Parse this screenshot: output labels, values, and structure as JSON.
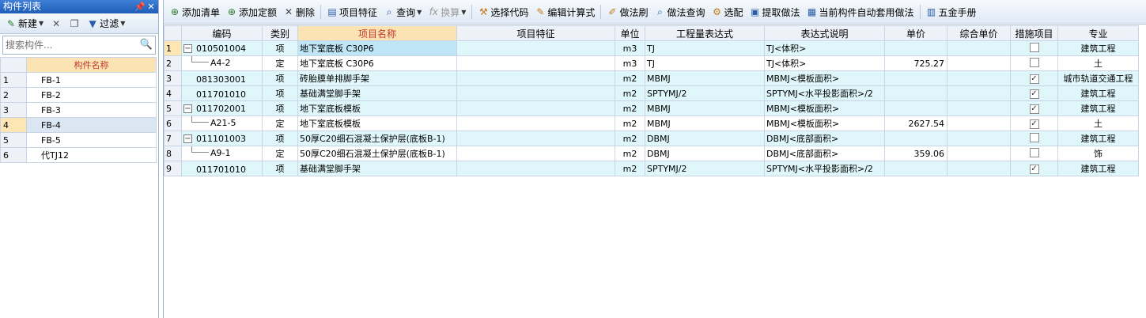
{
  "left_panel": {
    "title": "构件列表",
    "pin_icon": "pin-icon",
    "close_icon": "close-icon",
    "toolbar": {
      "new_label": "新建",
      "filter_label": "过滤"
    },
    "search": {
      "placeholder": "搜索构件..."
    },
    "table": {
      "header": "构件名称",
      "rows": [
        {
          "idx": "1",
          "name": "FB-1"
        },
        {
          "idx": "2",
          "name": "FB-2"
        },
        {
          "idx": "3",
          "name": "FB-3"
        },
        {
          "idx": "4",
          "name": "FB-4"
        },
        {
          "idx": "5",
          "name": "FB-5"
        },
        {
          "idx": "6",
          "name": "代TJ12"
        }
      ],
      "selected_index": 3
    }
  },
  "toolbar": {
    "add_list": "添加清单",
    "add_quota": "添加定额",
    "delete": "删除",
    "item_feature": "项目特征",
    "query": "查询",
    "convert": "换算",
    "select_code": "选择代码",
    "edit_formula": "编辑计算式",
    "method_brush": "做法刷",
    "method_query": "做法查询",
    "select_match": "选配",
    "extract_method": "提取做法",
    "auto_apply": "当前构件自动套用做法",
    "hardware_manual": "五金手册"
  },
  "grid": {
    "columns": [
      "编码",
      "类别",
      "项目名称",
      "项目特征",
      "单位",
      "工程量表达式",
      "表达式说明",
      "单价",
      "综合单价",
      "措施项目",
      "专业"
    ],
    "rows": [
      {
        "rn": "1",
        "code": "010501004",
        "type": "项",
        "name": "地下室底板 C30P6",
        "feature": "",
        "unit": "m3",
        "expr": "TJ",
        "desc": "TJ<体积>",
        "price": "",
        "total": "",
        "measure": false,
        "major": "建筑工程",
        "level": "parent",
        "cyan": true,
        "selected": true
      },
      {
        "rn": "2",
        "code": "A4-2",
        "type": "定",
        "name": "地下室底板 C30P6",
        "feature": "",
        "unit": "m3",
        "expr": "TJ",
        "desc": "TJ<体积>",
        "price": "725.27",
        "total": "",
        "measure": false,
        "major": "土",
        "level": "child",
        "cyan": false,
        "selected": false
      },
      {
        "rn": "3",
        "code": "081303001",
        "type": "项",
        "name": "砖胎膜单排脚手架",
        "feature": "",
        "unit": "m2",
        "expr": "MBMJ",
        "desc": "MBMJ<模板面积>",
        "price": "",
        "total": "",
        "measure": true,
        "major": "城市轨道交通工程",
        "level": "plain",
        "cyan": true,
        "selected": false
      },
      {
        "rn": "4",
        "code": "011701010",
        "type": "项",
        "name": "基础满堂脚手架",
        "feature": "",
        "unit": "m2",
        "expr": "SPTYMJ/2",
        "desc": "SPTYMJ<水平投影面积>/2",
        "price": "",
        "total": "",
        "measure": true,
        "major": "建筑工程",
        "level": "plain",
        "cyan": true,
        "selected": false
      },
      {
        "rn": "5",
        "code": "011702001",
        "type": "项",
        "name": "地下室底板模板",
        "feature": "",
        "unit": "m2",
        "expr": "MBMJ",
        "desc": "MBMJ<模板面积>",
        "price": "",
        "total": "",
        "measure": true,
        "major": "建筑工程",
        "level": "parent",
        "cyan": true,
        "selected": false
      },
      {
        "rn": "6",
        "code": "A21-5",
        "type": "定",
        "name": "地下室底板模板",
        "feature": "",
        "unit": "m2",
        "expr": "MBMJ",
        "desc": "MBMJ<模板面积>",
        "price": "2627.54",
        "total": "",
        "measure": true,
        "major": "土",
        "level": "child",
        "cyan": false,
        "selected": false
      },
      {
        "rn": "7",
        "code": "011101003",
        "type": "项",
        "name": "50厚C20细石混凝土保护层(底板B-1)",
        "feature": "",
        "unit": "m2",
        "expr": "DBMJ",
        "desc": "DBMJ<底部面积>",
        "price": "",
        "total": "",
        "measure": false,
        "major": "建筑工程",
        "level": "parent",
        "cyan": true,
        "selected": false
      },
      {
        "rn": "8",
        "code": "A9-1",
        "type": "定",
        "name": "50厚C20细石混凝土保护层(底板B-1)",
        "feature": "",
        "unit": "m2",
        "expr": "DBMJ",
        "desc": "DBMJ<底部面积>",
        "price": "359.06",
        "total": "",
        "measure": false,
        "major": "饰",
        "level": "child",
        "cyan": false,
        "selected": false
      },
      {
        "rn": "9",
        "code": "011701010",
        "type": "项",
        "name": "基础满堂脚手架",
        "feature": "",
        "unit": "m2",
        "expr": "SPTYMJ/2",
        "desc": "SPTYMJ<水平投影面积>/2",
        "price": "",
        "total": "",
        "measure": true,
        "major": "建筑工程",
        "level": "plain",
        "cyan": true,
        "selected": false
      }
    ]
  }
}
